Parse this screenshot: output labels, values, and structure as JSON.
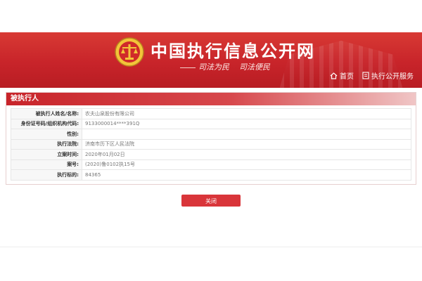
{
  "header": {
    "site_title": "中国执行信息公开网",
    "slogan_1": "司法为民",
    "slogan_2": "司法便民",
    "nav": [
      {
        "label": "首页",
        "icon": "home-icon"
      },
      {
        "label": "执行公开服务",
        "icon": "document-icon"
      }
    ]
  },
  "panel": {
    "title": "被执行人",
    "rows": [
      {
        "label": "被执行人姓名/名称:",
        "value": "农夫山泉股份有限公司"
      },
      {
        "label": "身份证号码/组织机构代码:",
        "value": "9133000014****391Q"
      },
      {
        "label": "性别:",
        "value": ""
      },
      {
        "label": "执行法院:",
        "value": "济南市历下区人民法院"
      },
      {
        "label": "立案时间:",
        "value": "2020年01月02日"
      },
      {
        "label": "案号:",
        "value": "(2020)鲁0102执15号"
      },
      {
        "label": "执行标的:",
        "value": "84365"
      }
    ]
  },
  "actions": {
    "close_label": "关闭"
  },
  "colors": {
    "brand_red": "#c8242a",
    "button_red": "#d9353a"
  }
}
